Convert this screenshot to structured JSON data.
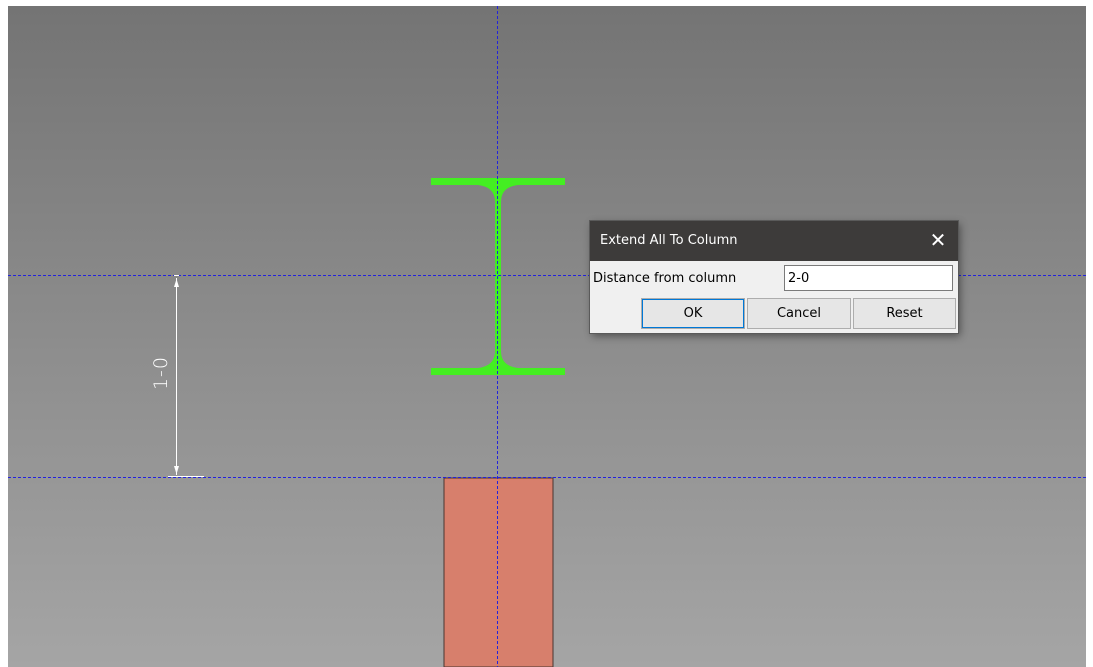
{
  "viewport": {
    "dimension_label": "1-0",
    "colors": {
      "guide_line": "#2222dd",
      "beam": "#44ee22",
      "column": "#d77f6c",
      "dimension": "#ffffff"
    }
  },
  "dialog": {
    "title": "Extend All To Column",
    "close_symbol": "✕",
    "distance_label": "Distance from column",
    "distance_value": "2-0",
    "ok_label": "OK",
    "cancel_label": "Cancel",
    "reset_label": "Reset"
  }
}
